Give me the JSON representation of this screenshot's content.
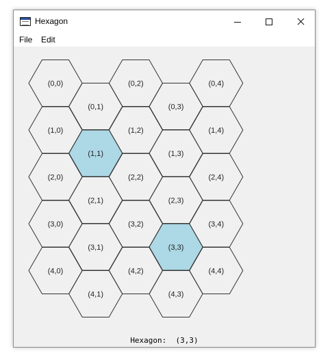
{
  "window": {
    "title": "Hexagon"
  },
  "menu": {
    "file_label": "File",
    "edit_label": "Edit"
  },
  "colors": {
    "highlight": "#add8e6",
    "hex_fill": "#f0f0f0",
    "hex_stroke": "#333333"
  },
  "grid": {
    "rows": 5,
    "cols": 5,
    "highlighted": [
      "1,1",
      "3,3"
    ],
    "labels": [
      [
        "(0,0)",
        "(0,1)",
        "(0,2)",
        "(0,3)",
        "(0,4)"
      ],
      [
        "(1,0)",
        "(1,1)",
        "(1,2)",
        "(1,3)",
        "(1,4)"
      ],
      [
        "(2,0)",
        "(2,1)",
        "(2,2)",
        "(2,3)",
        "(2,4)"
      ],
      [
        "(3,0)",
        "(3,1)",
        "(3,2)",
        "(3,3)",
        "(3,4)"
      ],
      [
        "(4,0)",
        "(4,1)",
        "(4,2)",
        "(4,3)",
        "(4,4)"
      ]
    ]
  },
  "status": {
    "label": "Hexagon:",
    "value": "(3,3)"
  }
}
